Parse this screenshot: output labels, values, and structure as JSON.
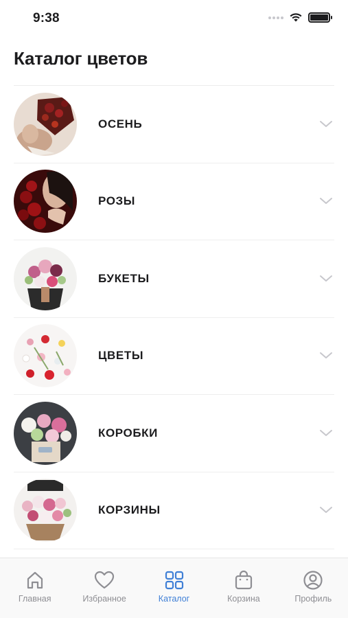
{
  "status": {
    "time": "9:38"
  },
  "page": {
    "title": "Каталог цветов"
  },
  "catalog": {
    "items": [
      {
        "label": "ОСЕНЬ",
        "image": "autumn-bouquet-photo"
      },
      {
        "label": "РОЗЫ",
        "image": "red-roses-photo"
      },
      {
        "label": "БУКЕТЫ",
        "image": "bouquet-photo"
      },
      {
        "label": "ЦВЕТЫ",
        "image": "flowers-flatlay-photo"
      },
      {
        "label": "КОРОБКИ",
        "image": "flower-box-photo"
      },
      {
        "label": "КОРЗИНЫ",
        "image": "flower-basket-photo"
      }
    ]
  },
  "tabbar": {
    "active": "catalog",
    "accent_color": "#3f7fd6",
    "inactive_color": "#8e8e93",
    "tabs": [
      {
        "id": "home",
        "label": "Главная",
        "icon": "home-icon"
      },
      {
        "id": "favorites",
        "label": "Избранное",
        "icon": "heart-icon"
      },
      {
        "id": "catalog",
        "label": "Каталог",
        "icon": "grid-icon"
      },
      {
        "id": "cart",
        "label": "Корзина",
        "icon": "bag-icon"
      },
      {
        "id": "profile",
        "label": "Профиль",
        "icon": "user-circle-icon"
      }
    ]
  }
}
